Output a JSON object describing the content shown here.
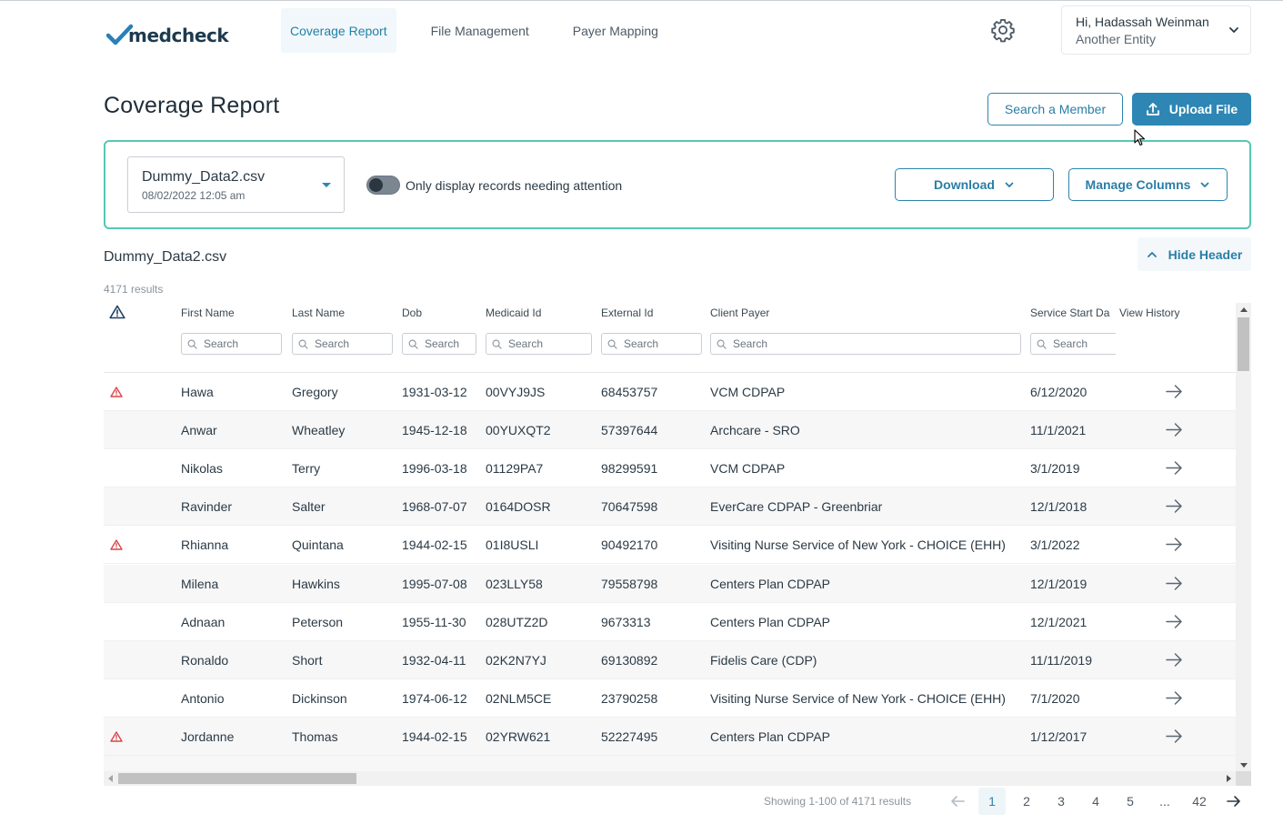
{
  "app": {
    "logo_text": "medcheck"
  },
  "nav": [
    {
      "label": "Coverage Report",
      "active": true
    },
    {
      "label": "File Management",
      "active": false
    },
    {
      "label": "Payer Mapping",
      "active": false
    }
  ],
  "user": {
    "greeting": "Hi, Hadassah Weinman",
    "entity": "Another Entity"
  },
  "page": {
    "title": "Coverage Report"
  },
  "actions": {
    "search_member": "Search a Member",
    "upload_file": "Upload File"
  },
  "filter": {
    "file_name": "Dummy_Data2.csv",
    "file_date": "08/02/2022 12:05 am",
    "toggle_label": "Only display records needing attention",
    "toggle_on": false,
    "download": "Download",
    "manage_columns": "Manage Columns"
  },
  "table": {
    "title": "Dummy_Data2.csv",
    "hide_header": "Hide Header",
    "results": "4171 results",
    "columns": {
      "first_name": "First Name",
      "last_name": "Last Name",
      "dob": "Dob",
      "medicaid_id": "Medicaid Id",
      "external_id": "External Id",
      "client_payer": "Client Payer",
      "service_start": "Service Start Da",
      "view_history": "View History"
    },
    "search_placeholder": "Search",
    "rows": [
      {
        "warning": true,
        "first": "Hawa",
        "last": "Gregory",
        "dob": "1931-03-12",
        "medicaid": "00VYJ9JS",
        "external": "68453757",
        "payer": "VCM CDPAP",
        "start": "6/12/2020"
      },
      {
        "warning": false,
        "first": "Anwar",
        "last": "Wheatley",
        "dob": "1945-12-18",
        "medicaid": "00YUXQT2",
        "external": "57397644",
        "payer": "Archcare - SRO",
        "start": "11/1/2021"
      },
      {
        "warning": false,
        "first": "Nikolas",
        "last": "Terry",
        "dob": "1996-03-18",
        "medicaid": "01129PA7",
        "external": "98299591",
        "payer": "VCM CDPAP",
        "start": "3/1/2019"
      },
      {
        "warning": false,
        "first": "Ravinder",
        "last": "Salter",
        "dob": "1968-07-07",
        "medicaid": "0164DOSR",
        "external": "70647598",
        "payer": "EverCare CDPAP - Greenbriar",
        "start": "12/1/2018"
      },
      {
        "warning": true,
        "first": "Rhianna",
        "last": "Quintana",
        "dob": "1944-02-15",
        "medicaid": "01I8USLI",
        "external": "90492170",
        "payer": "Visiting Nurse Service of New York - CHOICE (EHH)",
        "start": "3/1/2022"
      },
      {
        "warning": false,
        "first": "Milena",
        "last": "Hawkins",
        "dob": "1995-07-08",
        "medicaid": "023LLY58",
        "external": "79558798",
        "payer": "Centers Plan CDPAP",
        "start": "12/1/2019"
      },
      {
        "warning": false,
        "first": "Adnaan",
        "last": "Peterson",
        "dob": "1955-11-30",
        "medicaid": "028UTZ2D",
        "external": "9673313",
        "payer": "Centers Plan CDPAP",
        "start": "12/1/2021"
      },
      {
        "warning": false,
        "first": "Ronaldo",
        "last": "Short",
        "dob": "1932-04-11",
        "medicaid": "02K2N7YJ",
        "external": "69130892",
        "payer": "Fidelis Care (CDP)",
        "start": "11/11/2019"
      },
      {
        "warning": false,
        "first": "Antonio",
        "last": "Dickinson",
        "dob": "1974-06-12",
        "medicaid": "02NLM5CE",
        "external": "23790258",
        "payer": "Visiting Nurse Service of New York - CHOICE (EHH)",
        "start": "7/1/2020"
      },
      {
        "warning": true,
        "first": "Jordanne",
        "last": "Thomas",
        "dob": "1944-02-15",
        "medicaid": "02YRW621",
        "external": "52227495",
        "payer": "Centers Plan CDPAP",
        "start": "1/12/2017"
      }
    ]
  },
  "pagination": {
    "showing": "Showing 1-100 of 4171 results",
    "pages": [
      "1",
      "2",
      "3",
      "4",
      "5",
      "...",
      "42"
    ],
    "current": "1"
  },
  "colors": {
    "accent": "#2d86b4",
    "card_border": "#56c7b4",
    "warning": "#d9464b",
    "logo_check": "#2a7fb8"
  },
  "icons": {
    "settings": "gear-icon",
    "user_menu": "chevron-down-icon",
    "upload": "upload-icon",
    "hide_header": "chevron-up-icon",
    "attention": "warning-triangle-icon",
    "view_history": "arrow-right-icon",
    "pagination_prev": "arrow-left-icon",
    "pagination_next": "arrow-right-icon",
    "search": "search-icon"
  }
}
